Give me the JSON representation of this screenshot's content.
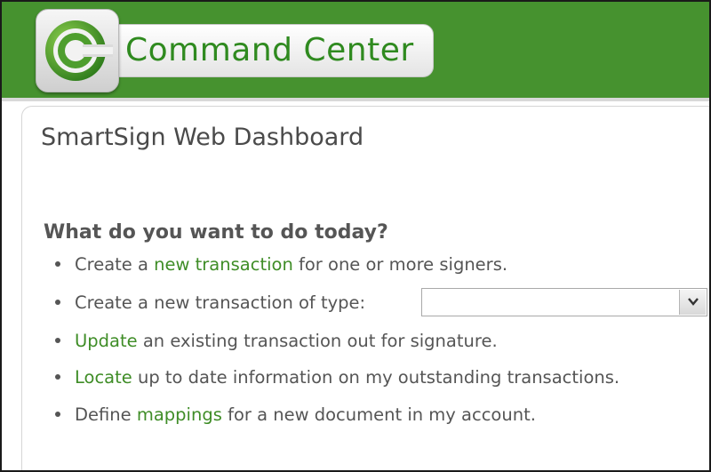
{
  "header": {
    "brand_name": "Command Center",
    "logo_icon": "command-center-c-logo",
    "bg_color": "#46922f"
  },
  "page": {
    "title": "SmartSign Web Dashboard",
    "prompt": "What do you want to do today?"
  },
  "options": {
    "item1": {
      "pre": "Create a ",
      "link": "new transaction",
      "post": " for one or more signers."
    },
    "item2": {
      "text": "Create a new transaction of type:",
      "select_value": ""
    },
    "item3": {
      "link": "Update",
      "post": " an existing transaction out for signature."
    },
    "item4": {
      "link": "Locate",
      "post": " up to date information on my outstanding transactions."
    },
    "item5": {
      "pre": "Define ",
      "link": "mappings",
      "post": " for a new document in my account."
    }
  },
  "colors": {
    "link": "#3f8d27",
    "text": "#555555"
  }
}
